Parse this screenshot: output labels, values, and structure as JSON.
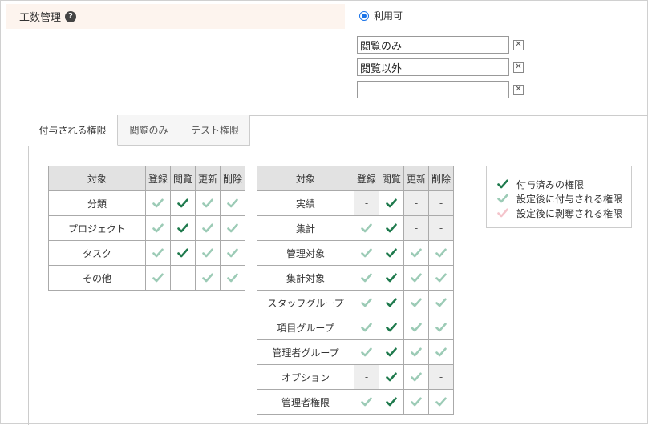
{
  "section": {
    "title": "工数管理",
    "help_icon": "?"
  },
  "radio": {
    "label": "利用可",
    "checked": true
  },
  "roles": [
    {
      "value": "閲覧のみ",
      "delete": "✕"
    },
    {
      "value": "閲覧以外",
      "delete": "✕"
    },
    {
      "value": "",
      "delete": "✕"
    }
  ],
  "tabs": [
    {
      "label": "付与される権限",
      "active": true
    },
    {
      "label": "閲覧のみ",
      "active": false
    },
    {
      "label": "テスト権限",
      "active": false
    }
  ],
  "colors": {
    "granted": "#1f7a4d",
    "to_grant": "#9ccbb6",
    "to_revoke": "#f4c4cb",
    "accent": "#1a73e8"
  },
  "table1": {
    "headers": [
      "対象",
      "登録",
      "閲覧",
      "更新",
      "削除"
    ],
    "rows": [
      {
        "label": "分類",
        "cells": [
          "to_grant",
          "granted",
          "to_grant",
          "to_grant"
        ]
      },
      {
        "label": "プロジェクト",
        "cells": [
          "to_grant",
          "granted",
          "to_grant",
          "to_grant"
        ]
      },
      {
        "label": "タスク",
        "cells": [
          "to_grant",
          "granted",
          "to_grant",
          "to_grant"
        ]
      },
      {
        "label": "その他",
        "cells": [
          "to_grant",
          "empty",
          "to_grant",
          "to_grant"
        ]
      }
    ]
  },
  "table2": {
    "headers": [
      "対象",
      "登録",
      "閲覧",
      "更新",
      "削除"
    ],
    "rows": [
      {
        "label": "実績",
        "cells": [
          "na",
          "granted",
          "na",
          "na"
        ]
      },
      {
        "label": "集計",
        "cells": [
          "to_grant",
          "granted",
          "na",
          "na"
        ]
      },
      {
        "label": "管理対象",
        "cells": [
          "to_grant",
          "granted",
          "to_grant",
          "to_grant"
        ]
      },
      {
        "label": "集計対象",
        "cells": [
          "to_grant",
          "granted",
          "to_grant",
          "to_grant"
        ]
      },
      {
        "label": "スタッフグループ",
        "cells": [
          "to_grant",
          "granted",
          "to_grant",
          "to_grant"
        ]
      },
      {
        "label": "項目グループ",
        "cells": [
          "to_grant",
          "granted",
          "to_grant",
          "to_grant"
        ]
      },
      {
        "label": "管理者グループ",
        "cells": [
          "to_grant",
          "granted",
          "to_grant",
          "to_grant"
        ]
      },
      {
        "label": "オプション",
        "cells": [
          "na",
          "granted",
          "to_grant",
          "na"
        ]
      },
      {
        "label": "管理者権限",
        "cells": [
          "to_grant",
          "granted",
          "to_grant",
          "to_grant"
        ]
      }
    ]
  },
  "na_text": "-",
  "legend": [
    {
      "kind": "granted",
      "label": "付与済みの権限"
    },
    {
      "kind": "to_grant",
      "label": "設定後に付与される権限"
    },
    {
      "kind": "to_revoke",
      "label": "設定後に剥奪される権限"
    }
  ]
}
